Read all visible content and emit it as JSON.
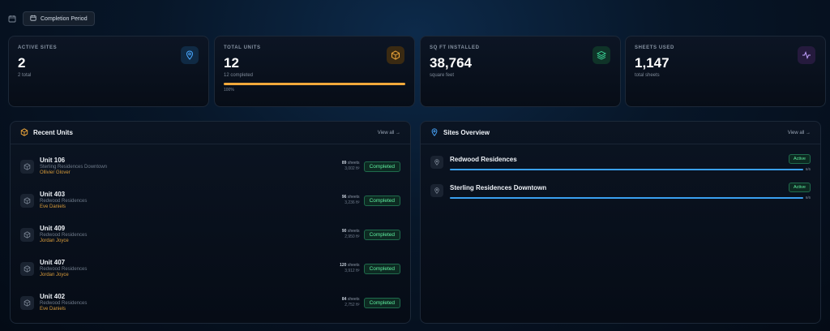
{
  "topbar": {
    "period_label": "Completion Period"
  },
  "stats": [
    {
      "label": "ACTIVE SITES",
      "value": "2",
      "sub": "2 total",
      "icon": "map-pin-icon",
      "color": "#4aa8ff"
    },
    {
      "label": "TOTAL UNITS",
      "value": "12",
      "sub": "12 completed",
      "icon": "cube-icon",
      "color": "#f2a93b",
      "progress_text": "100%",
      "progress": 1.0
    },
    {
      "label": "SQ FT INSTALLED",
      "value": "38,764",
      "sub": "square feet",
      "icon": "layers-icon",
      "color": "#3fe0a0"
    },
    {
      "label": "SHEETS USED",
      "value": "1,147",
      "sub": "total sheets",
      "icon": "activity-icon",
      "color": "#b58cff"
    }
  ],
  "recent_units": {
    "title": "Recent Units",
    "view_all": "View all →",
    "items": [
      {
        "name": "Unit 106",
        "site": "Sterling Residences Downtown",
        "person": "Ollivier Glover",
        "sheets": "89",
        "sheets_unit": "sheets",
        "sqft": "3,002 ft²",
        "status": "Completed"
      },
      {
        "name": "Unit 403",
        "site": "Redwood Residences",
        "person": "Eve Daniels",
        "sheets": "96",
        "sheets_unit": "sheets",
        "sqft": "3,236 ft²",
        "status": "Completed"
      },
      {
        "name": "Unit 409",
        "site": "Redwood Residences",
        "person": "Jordan Joyce",
        "sheets": "90",
        "sheets_unit": "sheets",
        "sqft": "2,950 ft²",
        "status": "Completed"
      },
      {
        "name": "Unit 407",
        "site": "Redwood Residences",
        "person": "Jordan Joyce",
        "sheets": "120",
        "sheets_unit": "sheets",
        "sqft": "3,912 ft²",
        "status": "Completed"
      },
      {
        "name": "Unit 402",
        "site": "Redwood Residences",
        "person": "Eve Daniels",
        "sheets": "84",
        "sheets_unit": "sheets",
        "sqft": "2,752 ft²",
        "status": "Completed"
      }
    ]
  },
  "sites_overview": {
    "title": "Sites Overview",
    "view_all": "View all →",
    "items": [
      {
        "name": "Redwood Residences",
        "status": "Active",
        "fraction": "6/6",
        "progress": 1.0
      },
      {
        "name": "Sterling Residences Downtown",
        "status": "Active",
        "fraction": "6/6",
        "progress": 1.0
      }
    ]
  }
}
